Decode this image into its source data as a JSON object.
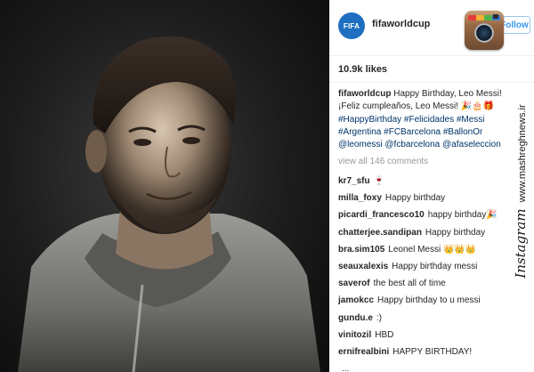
{
  "post": {
    "username": "fifaworldcup",
    "avatar_text": "FIFA",
    "follow_label": "Follow",
    "likes": "10.9k likes",
    "caption": {
      "user": "fifaworldcup",
      "line1": "Happy Birthday, Leo Messi!",
      "line2": "¡Feliz cumpleaños, Leo Messi! 🎉🎂🎁",
      "line3": "#HappyBirthday #Felicidades #Messi",
      "line4": "#Argentina #FCBarcelona #BallonOr",
      "line5": "@leomessi @fcbarcelona @afaseleccion"
    },
    "view_all": "view all 146 comments",
    "comments": [
      {
        "user": "kr7_sfu",
        "text": "🍷"
      },
      {
        "user": "milla_foxy",
        "text": "Happy birthday"
      },
      {
        "user": "picardi_francesco10",
        "text": "happy birthday🎉"
      },
      {
        "user": "chatterjee.sandipan",
        "text": "Happy birthday"
      },
      {
        "user": "bra.sim105",
        "text": "Leonel Messi 👑👑👑"
      },
      {
        "user": "seauxalexis",
        "text": "Happy birthday messi"
      },
      {
        "user": "saverof",
        "text": "the best all of time"
      },
      {
        "user": "jamokcc",
        "text": "Happy birthday to u messi"
      },
      {
        "user": "gundu.e",
        "text": ":)"
      },
      {
        "user": "vinitozil",
        "text": "HBD"
      },
      {
        "user": "ernifrealbini",
        "text": "HAPPY BIRTHDAY!"
      },
      {
        "user": "",
        "text": "..."
      }
    ]
  },
  "watermark": {
    "brand": "Instagram",
    "site": "www.mashreghnews.ir"
  },
  "colors": {
    "link_blue": "#3897f0",
    "hashtag": "#003569",
    "fifa_blue": "#1f6fc0",
    "muted": "#999999"
  },
  "icons": {
    "app_logo": "instagram-camera-icon"
  }
}
